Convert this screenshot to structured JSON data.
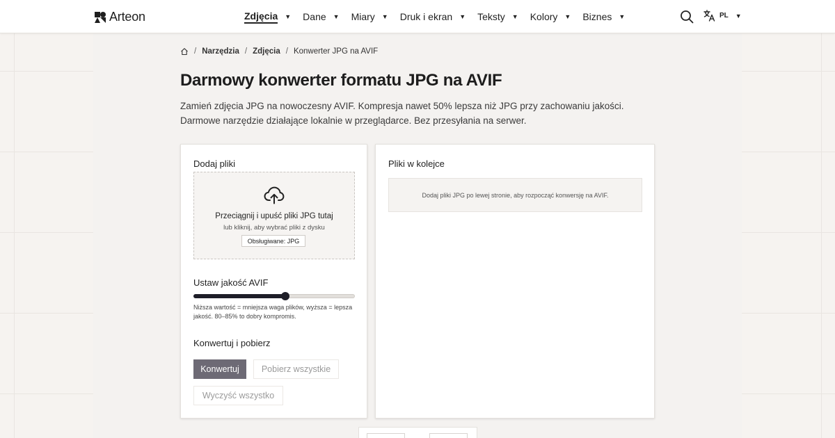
{
  "brand": {
    "name": "Arteon"
  },
  "nav": {
    "items": [
      {
        "label": "Zdjęcia",
        "active": true
      },
      {
        "label": "Dane",
        "active": false
      },
      {
        "label": "Miary",
        "active": false
      },
      {
        "label": "Druk i ekran",
        "active": false
      },
      {
        "label": "Teksty",
        "active": false
      },
      {
        "label": "Kolory",
        "active": false
      },
      {
        "label": "Biznes",
        "active": false
      }
    ],
    "search_icon": "search-icon",
    "language": {
      "code": "PL",
      "icon": "translate-icon"
    }
  },
  "breadcrumb": {
    "home_icon": "home-icon",
    "items": [
      "Narzędzia",
      "Zdjęcia",
      "Konwerter JPG na AVIF"
    ]
  },
  "page": {
    "title": "Darmowy konwerter formatu JPG na AVIF",
    "description": "Zamień zdjęcia JPG na nowoczesny AVIF. Kompresja nawet 50% lepsza niż JPG przy zachowaniu jakości. Darmowe narzędzie działające lokalnie w przeglądarce. Bez przesyłania na serwer."
  },
  "upload": {
    "heading": "Dodaj pliki",
    "icon": "cloud-upload-icon",
    "title": "Przeciągnij i upuść pliki JPG tutaj",
    "subtitle": "lub kliknij, aby wybrać pliki z dysku",
    "supported": "Obsługiwane: JPG"
  },
  "quality": {
    "heading": "Ustaw jakość AVIF",
    "value_fraction": 0.57,
    "hint": "Niższa wartość = mniejsza waga plików, wyższa = lepsza jakość. 80–85% to dobry kompromis."
  },
  "actions": {
    "heading": "Konwertuj i pobierz",
    "convert_label": "Konwertuj",
    "download_all_label": "Pobierz wszystkie",
    "clear_all_label": "Wyczyść wszystko"
  },
  "queue": {
    "heading": "Pliki w kolejce",
    "empty_message": "Dodaj pliki JPG po lewej stronie, aby rozpocząć konwersję na AVIF."
  },
  "colors": {
    "primary_button": "#6d6a75",
    "slider_fill": "#1e1e28",
    "background": "#f6f3f0"
  }
}
